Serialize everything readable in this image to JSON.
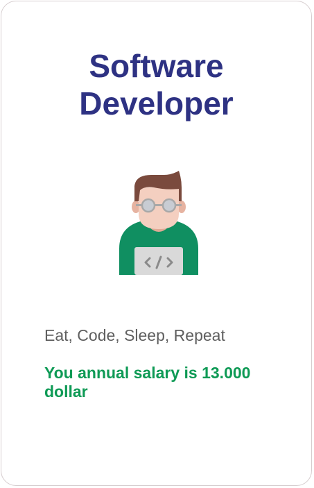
{
  "card": {
    "title_line1": "Software",
    "title_line2": "Developer",
    "tagline": "Eat, Code, Sleep, Repeat",
    "salary": "You annual salary is 13.000 dollar",
    "avatar_icon": "developer-avatar-icon"
  },
  "colors": {
    "title": "#2e3283",
    "tagline": "#5f5f5f",
    "salary": "#0e9a55",
    "shirt": "#108f61",
    "laptop": "#d9d9d9",
    "hair": "#7a4a3d",
    "skin": "#f2c7b6"
  }
}
